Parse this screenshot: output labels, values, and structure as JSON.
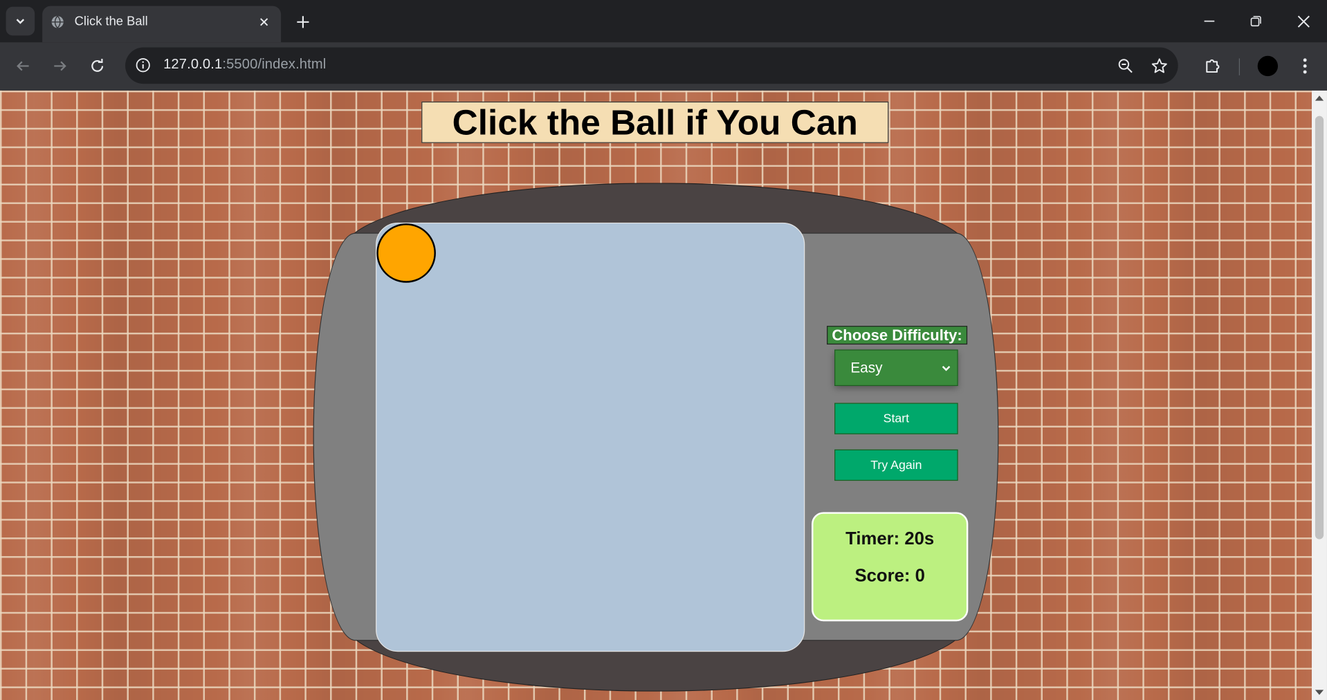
{
  "browser": {
    "tab_title": "Click the Ball",
    "url_host": "127.0.0.1",
    "url_rest": ":5500/index.html"
  },
  "page": {
    "heading": "Click the Ball if You Can",
    "difficulty_label": "Choose Difficulty:",
    "difficulty_selected": "Easy",
    "start_label": "Start",
    "try_again_label": "Try Again",
    "timer_text": "Timer: 20s",
    "score_text": "Score: 0"
  },
  "colors": {
    "ball": "#ffa500",
    "screen": "#b0c4d8",
    "buttons": "#00a86b",
    "difficulty": "#3a8a3c",
    "status_panel": "#bcf080",
    "heading_bg": "#f5deb3"
  }
}
